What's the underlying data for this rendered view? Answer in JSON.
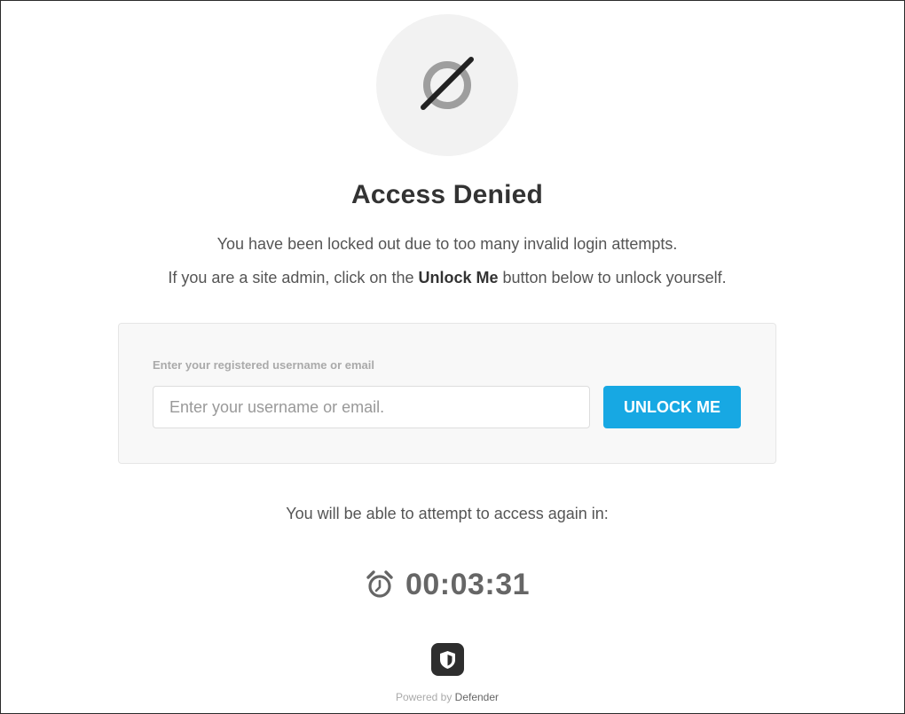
{
  "header": {
    "icon": "forbidden-icon",
    "title": "Access Denied"
  },
  "messages": {
    "line1": "You have been locked out due to too many invalid login attempts.",
    "line2_prefix": "If you are a site admin, click on the ",
    "line2_bold": "Unlock Me",
    "line2_suffix": " button below to unlock yourself."
  },
  "unlock_form": {
    "label": "Enter your registered username or email",
    "input_value": "",
    "input_placeholder": "Enter your username or email.",
    "button_label": "UNLOCK ME"
  },
  "countdown": {
    "label": "You will be able to attempt to access again in:",
    "icon": "alarm-clock-icon",
    "time": "00:03:31"
  },
  "footer": {
    "logo_icon": "shield-icon",
    "powered_prefix": "Powered by ",
    "brand": "Defender"
  },
  "colors": {
    "accent": "#17a8e3",
    "title": "#333333",
    "body_text": "#555555",
    "muted": "#aaaaaa"
  }
}
